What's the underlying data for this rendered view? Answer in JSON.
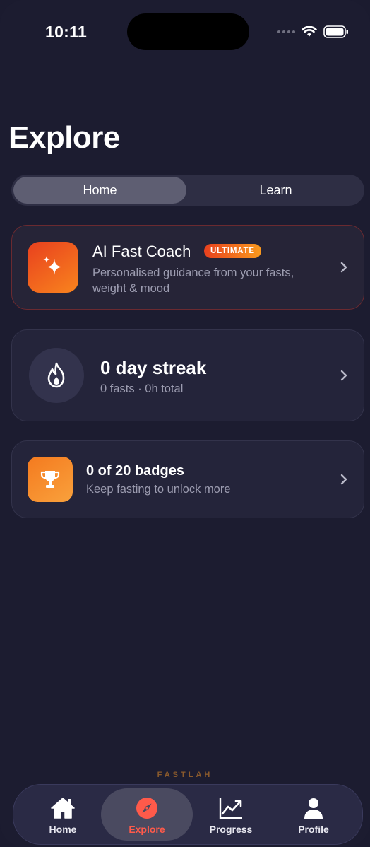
{
  "status_bar": {
    "time": "10:11"
  },
  "page": {
    "title": "Explore"
  },
  "segmented": {
    "tabs": [
      "Home",
      "Learn"
    ],
    "selected": "Home"
  },
  "coach_card": {
    "title": "AI Fast Coach",
    "badge": "ULTIMATE",
    "subtitle": "Personalised guidance from your fasts, weight & mood",
    "icon": "sparkles-icon"
  },
  "streak_card": {
    "title": "0 day streak",
    "subtitle": "0 fasts · 0h total",
    "icon": "flame-icon"
  },
  "badges_card": {
    "title": "0 of 20 badges",
    "subtitle": "Keep fasting to unlock more",
    "icon": "trophy-icon"
  },
  "brand": "FASTLAH",
  "tab_bar": {
    "items": [
      {
        "label": "Home",
        "icon": "house-icon"
      },
      {
        "label": "Explore",
        "icon": "compass-icon"
      },
      {
        "label": "Progress",
        "icon": "chart-icon"
      },
      {
        "label": "Profile",
        "icon": "person-icon"
      }
    ],
    "selected": "Explore",
    "active_color": "#ff5a4a"
  },
  "colors": {
    "background": "#1c1c30",
    "accent": "#f26b1f"
  }
}
